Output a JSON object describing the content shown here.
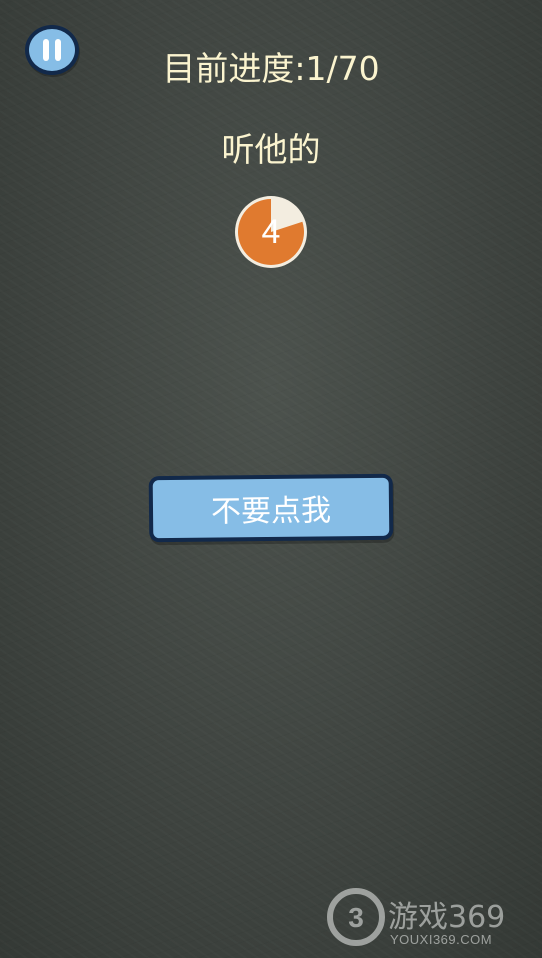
{
  "header": {
    "progress_text": "目前进度:1/70",
    "pause_icon": "pause-icon"
  },
  "level": {
    "instruction": "听他的",
    "countdown": "4",
    "countdown_remaining_fraction": 0.8,
    "countdown_color": "#e07a2f"
  },
  "main_button": {
    "label": "不要点我",
    "color": "#86bde6"
  },
  "watermark": {
    "name": "游戏369",
    "url": "YOUXI369.COM",
    "logo_digit": "3"
  }
}
